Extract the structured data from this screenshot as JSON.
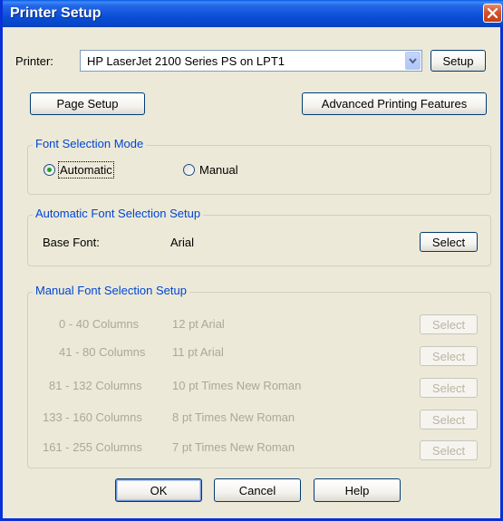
{
  "window": {
    "title": "Printer Setup"
  },
  "printer": {
    "label": "Printer:",
    "selected": "HP LaserJet 2100 Series PS on LPT1",
    "setup_button": "Setup"
  },
  "buttons": {
    "page_setup": "Page Setup",
    "advanced": "Advanced Printing Features",
    "ok": "OK",
    "cancel": "Cancel",
    "help": "Help"
  },
  "font_mode": {
    "title": "Font Selection Mode",
    "automatic": "Automatic",
    "manual": "Manual",
    "selected": "Automatic"
  },
  "auto_setup": {
    "title": "Automatic Font Selection Setup",
    "base_font_label": "Base Font:",
    "base_font_value": "Arial",
    "select_button": "Select"
  },
  "manual_setup": {
    "title": "Manual Font Selection Setup",
    "rows": [
      {
        "columns": "0 - 40 Columns",
        "font": "12 pt Arial",
        "button": "Select"
      },
      {
        "columns": "41 - 80 Columns",
        "font": "11 pt Arial",
        "button": "Select"
      },
      {
        "columns": "81 - 132 Columns",
        "font": "10 pt Times New Roman",
        "button": "Select"
      },
      {
        "columns": "133 - 160 Columns",
        "font": "8 pt Times New Roman",
        "button": "Select"
      },
      {
        "columns": "161 - 255 Columns",
        "font": "7 pt Times New Roman",
        "button": "Select"
      }
    ]
  },
  "icons": {
    "close": "close-icon",
    "dropdown": "chevron-down-icon"
  },
  "colors": {
    "titlebar": "#0a4fd6",
    "group_title": "#0046d5",
    "dialog_bg": "#ece9d8",
    "close_button": "#d6512a"
  }
}
